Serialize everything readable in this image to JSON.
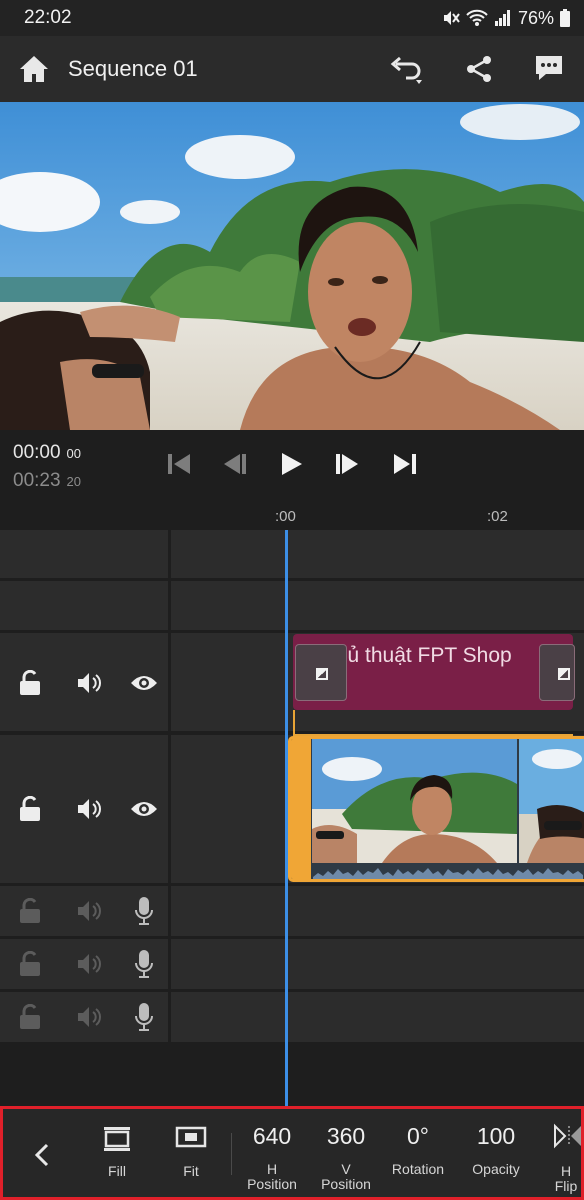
{
  "status": {
    "time": "22:02",
    "battery": "76%"
  },
  "header": {
    "title": "Sequence 01"
  },
  "transport": {
    "current_main": "00:00",
    "current_frames": "00",
    "duration_main": "00:23",
    "duration_frames": "20"
  },
  "ruler": {
    "marks": [
      ":00",
      ":02"
    ]
  },
  "title_clip": {
    "label": "Thủ thuật FPT Shop"
  },
  "toolbar": {
    "fill": "Fill",
    "fit": "Fit",
    "h_position_value": "640",
    "h_position_label_1": "H",
    "h_position_label_2": "Position",
    "v_position_value": "360",
    "v_position_label_1": "V",
    "v_position_label_2": "Position",
    "rotation_value": "0°",
    "rotation_label": "Rotation",
    "opacity_value": "100",
    "opacity_label": "Opacity",
    "hflip_label_1": "H",
    "hflip_label_2": "Flip"
  },
  "colors": {
    "accent_blue": "#3d8fe6",
    "clip_orange": "#f0a636",
    "title_clip": "#7a1f47",
    "highlight_red": "#e0202a"
  }
}
